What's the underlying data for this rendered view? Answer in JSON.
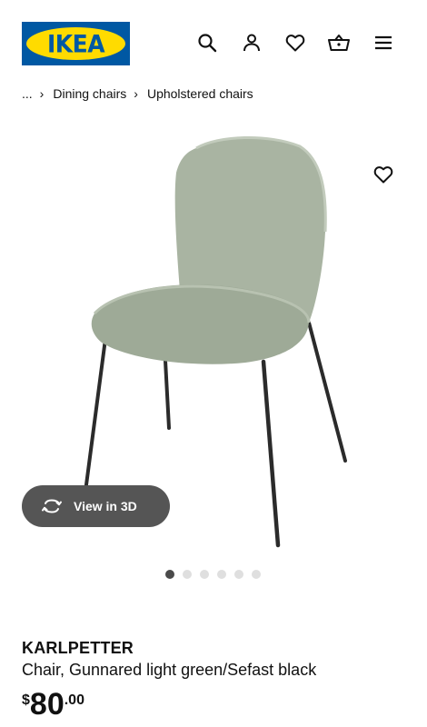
{
  "header": {
    "logo_text": "IKEA",
    "icons": [
      "search-icon",
      "user-icon",
      "heart-icon",
      "basket-icon",
      "menu-icon"
    ]
  },
  "breadcrumb": {
    "ellipsis": "...",
    "separator": "›",
    "items": [
      "Dining chairs",
      "Upholstered chairs"
    ]
  },
  "gallery": {
    "view3d_label": "View in 3D",
    "dot_count": 6,
    "active_index": 0
  },
  "product": {
    "name": "KARLPETTER",
    "description": "Chair, Gunnared light green/Sefast black",
    "price": {
      "currency": "$",
      "integer": "80",
      "decimal": ".00"
    }
  },
  "colors": {
    "brand_blue": "#0058a3",
    "brand_yellow": "#ffdb00",
    "chair_fabric": "#a9b4a2",
    "chair_legs": "#2b2b2b",
    "view3d_bg": "#555555"
  }
}
